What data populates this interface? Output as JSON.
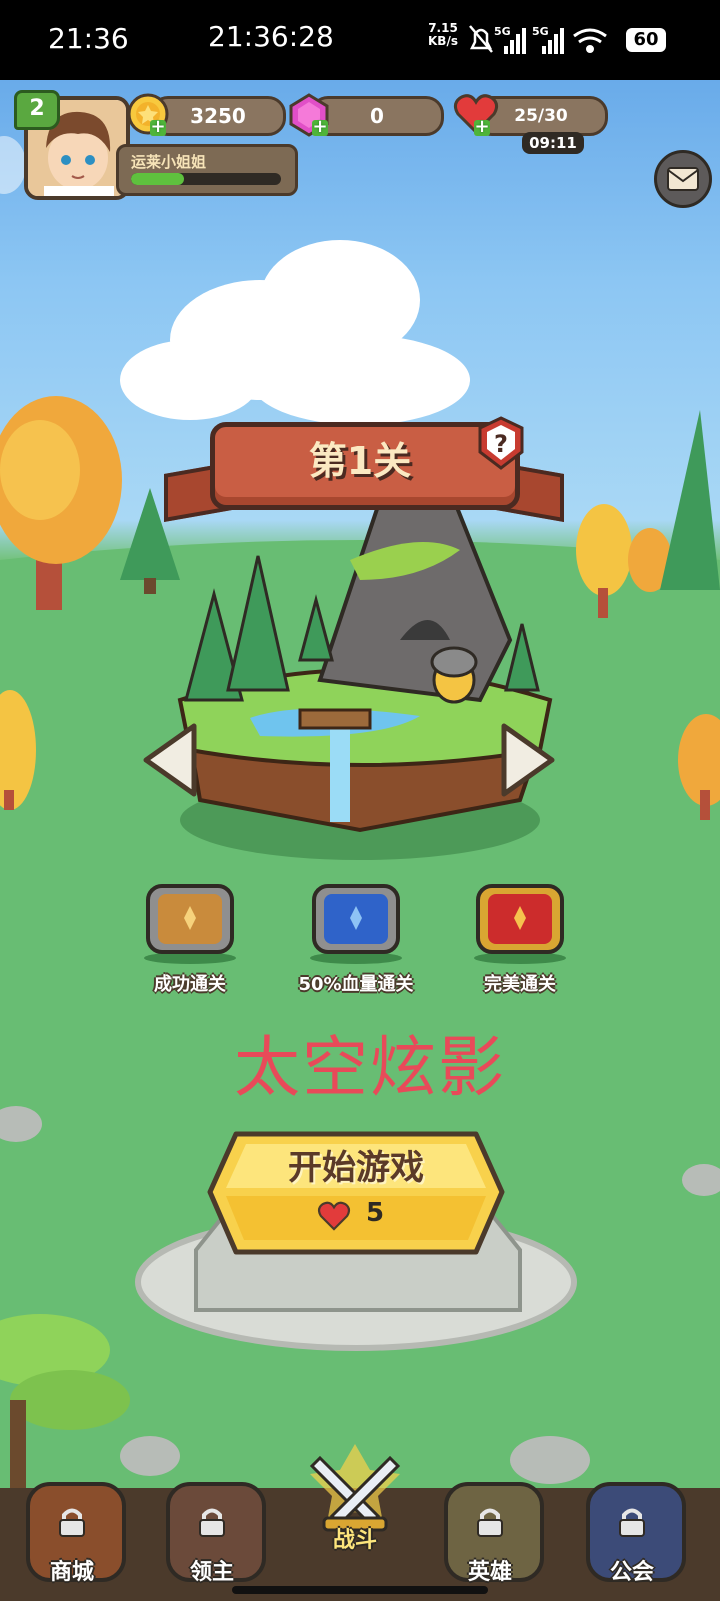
{
  "status_bar": {
    "time_left": "21:36",
    "time_center": "21:36:28",
    "net_speed_top": "7.15",
    "net_speed_unit": "KB/s",
    "signal_1": "5G",
    "signal_2": "5G",
    "battery": "60"
  },
  "player": {
    "level": "2",
    "name": "运莱小姐姐",
    "exp_fraction": 0.35
  },
  "resources": {
    "gold": "3250",
    "gems": "0",
    "stamina": "25/30",
    "stamina_timer": "09:11"
  },
  "stage": {
    "title": "第1关"
  },
  "rewards": [
    {
      "label": "成功通关"
    },
    {
      "label": "50%血量通关"
    },
    {
      "label": "完美通关"
    }
  ],
  "overlay_text": "太空炫影",
  "start": {
    "label": "开始游戏",
    "cost": "5"
  },
  "nav": [
    {
      "label": "商城"
    },
    {
      "label": "领主"
    },
    {
      "label": "战斗"
    },
    {
      "label": "英雄"
    },
    {
      "label": "公会"
    }
  ],
  "colors": {
    "sky_top": "#5ba0e6",
    "grass": "#63b86e",
    "banner": "#c95e44",
    "start_button": "#f8d14c",
    "watermark": "#e84a59"
  }
}
